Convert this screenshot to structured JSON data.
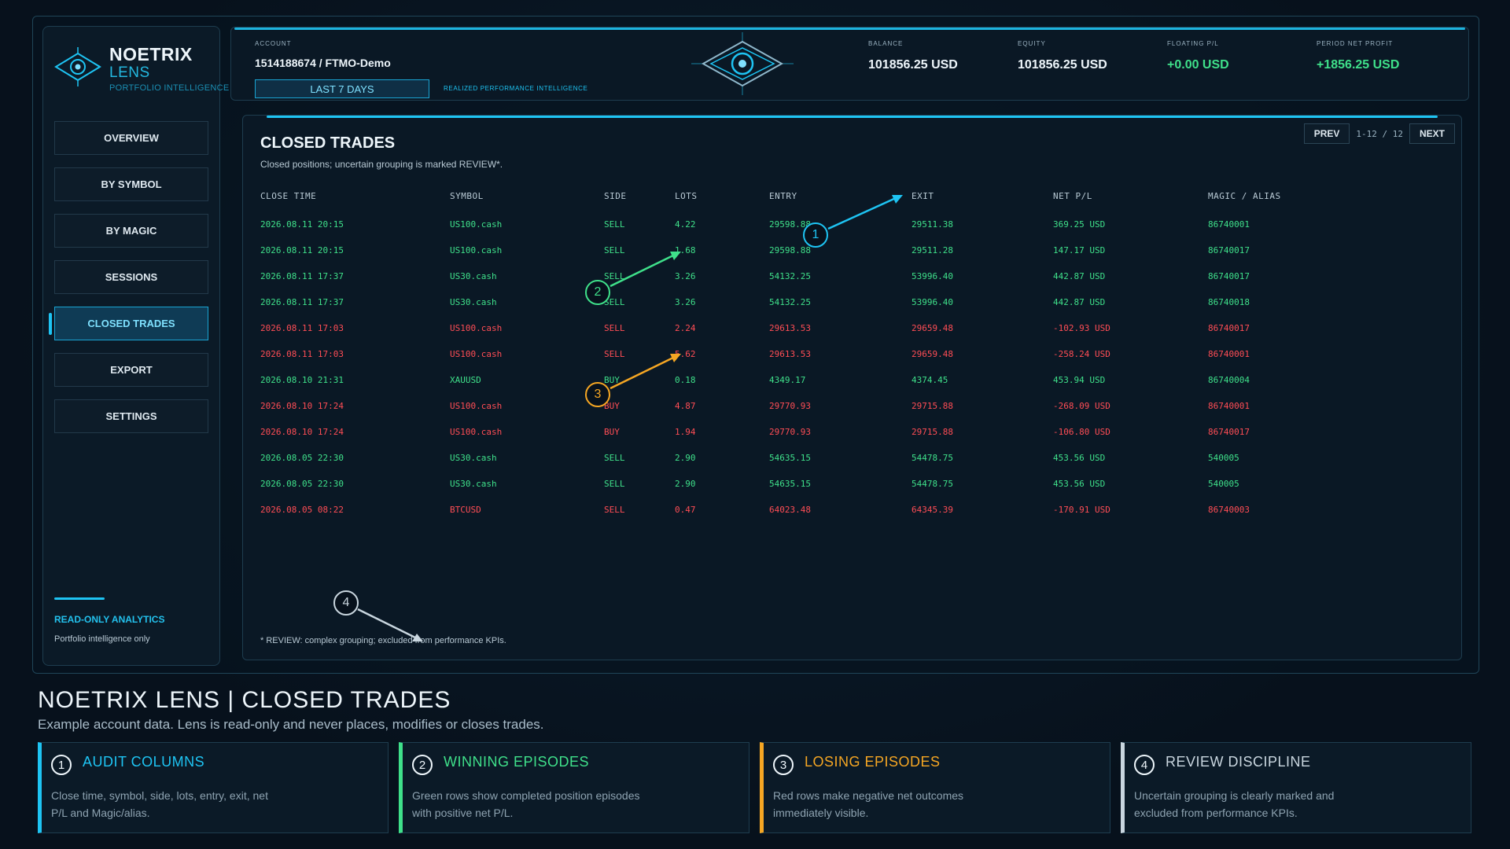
{
  "brand": {
    "name": "NOETRIX",
    "product": "LENS",
    "tagline": "PORTFOLIO INTELLIGENCE"
  },
  "nav": [
    {
      "label": "OVERVIEW",
      "active": false
    },
    {
      "label": "BY SYMBOL",
      "active": false
    },
    {
      "label": "BY MAGIC",
      "active": false
    },
    {
      "label": "SESSIONS",
      "active": false
    },
    {
      "label": "CLOSED TRADES",
      "active": true
    },
    {
      "label": "EXPORT",
      "active": false
    },
    {
      "label": "SETTINGS",
      "active": false
    }
  ],
  "sidebar_footer": {
    "title": "READ-ONLY ANALYTICS",
    "subtitle": "Portfolio intelligence only"
  },
  "header": {
    "account_label": "ACCOUNT",
    "account_value": "1514188674 / FTMO-Demo",
    "range_button": "LAST 7 DAYS",
    "tagline": "REALIZED PERFORMANCE INTELLIGENCE",
    "metrics": [
      {
        "label": "BALANCE",
        "value": "101856.25 USD",
        "green": false
      },
      {
        "label": "EQUITY",
        "value": "101856.25 USD",
        "green": false
      },
      {
        "label": "FLOATING P/L",
        "value": "+0.00 USD",
        "green": true
      },
      {
        "label": "PERIOD NET PROFIT",
        "value": "+1856.25 USD",
        "green": true
      }
    ]
  },
  "panel": {
    "title": "CLOSED TRADES",
    "subtitle": "Closed positions; uncertain grouping is marked REVIEW*.",
    "pager": {
      "prev": "PREV",
      "info": "1-12 / 12",
      "next": "NEXT"
    },
    "columns": [
      "CLOSE TIME",
      "SYMBOL",
      "SIDE",
      "LOTS",
      "ENTRY",
      "EXIT",
      "NET P/L",
      "MAGIC / ALIAS"
    ],
    "rows": [
      {
        "status": "pos",
        "cells": [
          "2026.08.11 20:15",
          "US100.cash",
          "SELL",
          "4.22",
          "29598.88",
          "29511.38",
          "369.25 USD",
          "86740001"
        ]
      },
      {
        "status": "pos",
        "cells": [
          "2026.08.11 20:15",
          "US100.cash",
          "SELL",
          "1.68",
          "29598.88",
          "29511.28",
          "147.17 USD",
          "86740017"
        ]
      },
      {
        "status": "pos",
        "cells": [
          "2026.08.11 17:37",
          "US30.cash",
          "SELL",
          "3.26",
          "54132.25",
          "53996.40",
          "442.87 USD",
          "86740017"
        ]
      },
      {
        "status": "pos",
        "cells": [
          "2026.08.11 17:37",
          "US30.cash",
          "SELL",
          "3.26",
          "54132.25",
          "53996.40",
          "442.87 USD",
          "86740018"
        ]
      },
      {
        "status": "neg",
        "cells": [
          "2026.08.11 17:03",
          "US100.cash",
          "SELL",
          "2.24",
          "29613.53",
          "29659.48",
          "-102.93 USD",
          "86740017"
        ]
      },
      {
        "status": "neg",
        "cells": [
          "2026.08.11 17:03",
          "US100.cash",
          "SELL",
          "5.62",
          "29613.53",
          "29659.48",
          "-258.24 USD",
          "86740001"
        ]
      },
      {
        "status": "pos",
        "cells": [
          "2026.08.10 21:31",
          "XAUUSD",
          "BUY",
          "0.18",
          "4349.17",
          "4374.45",
          "453.94 USD",
          "86740004"
        ]
      },
      {
        "status": "neg",
        "cells": [
          "2026.08.10 17:24",
          "US100.cash",
          "BUY",
          "4.87",
          "29770.93",
          "29715.88",
          "-268.09 USD",
          "86740001"
        ]
      },
      {
        "status": "neg",
        "cells": [
          "2026.08.10 17:24",
          "US100.cash",
          "BUY",
          "1.94",
          "29770.93",
          "29715.88",
          "-106.80 USD",
          "86740017"
        ]
      },
      {
        "status": "pos",
        "cells": [
          "2026.08.05 22:30",
          "US30.cash",
          "SELL",
          "2.90",
          "54635.15",
          "54478.75",
          "453.56 USD",
          "540005"
        ]
      },
      {
        "status": "pos",
        "cells": [
          "2026.08.05 22:30",
          "US30.cash",
          "SELL",
          "2.90",
          "54635.15",
          "54478.75",
          "453.56 USD",
          "540005"
        ]
      },
      {
        "status": "neg",
        "cells": [
          "2026.08.05 08:22",
          "BTCUSD",
          "SELL",
          "0.47",
          "64023.48",
          "64345.39",
          "-170.91 USD",
          "86740003"
        ]
      }
    ],
    "footnote": "* REVIEW: complex grouping; excluded from performance KPIs."
  },
  "callouts": [
    {
      "num": "1",
      "color": "#1ec4f3"
    },
    {
      "num": "2",
      "color": "#3fe08a"
    },
    {
      "num": "3",
      "color": "#f5a623"
    },
    {
      "num": "4",
      "color": "#c9d6df"
    }
  ],
  "bottom": {
    "title": "NOETRIX LENS | CLOSED TRADES",
    "subtitle": "Example account data. Lens is read-only and never places, modifies or closes trades.",
    "cards": [
      {
        "num": "1",
        "title": "AUDIT COLUMNS",
        "desc": "Close time, symbol, side, lots, entry, exit, net P/L and Magic/alias.",
        "color": "#1ec4f3"
      },
      {
        "num": "2",
        "title": "WINNING EPISODES",
        "desc": "Green rows show completed position episodes with positive net P/L.",
        "color": "#3fe08a"
      },
      {
        "num": "3",
        "title": "LOSING EPISODES",
        "desc": "Red rows make negative net outcomes immediately visible.",
        "color": "#f5a623"
      },
      {
        "num": "4",
        "title": "REVIEW DISCIPLINE",
        "desc": "Uncertain grouping is clearly marked and excluded from performance KPIs.",
        "color": "#c9d6df"
      }
    ]
  }
}
